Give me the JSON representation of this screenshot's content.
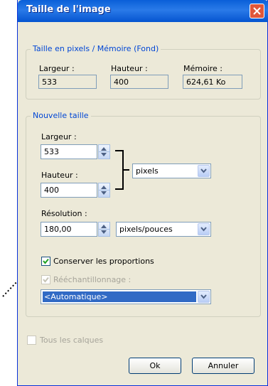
{
  "window": {
    "title": "Taille de l'image"
  },
  "pixel_group": {
    "legend": "Taille en pixels / Mémoire (Fond)",
    "width_label": "Largeur :",
    "width_value": "533",
    "height_label": "Hauteur :",
    "height_value": "400",
    "memory_label": "Mémoire :",
    "memory_value": "624,61 Ko"
  },
  "new_size": {
    "legend": "Nouvelle taille",
    "width_label": "Largeur :",
    "width_value": "533",
    "height_label": "Hauteur :",
    "height_value": "400",
    "unit_select": "pixels",
    "resolution_label": "Résolution :",
    "resolution_value": "180,00",
    "resolution_unit_select": "pixels/pouces",
    "keep_proportions_label": "Conserver les proportions",
    "keep_proportions_checked": true,
    "resample_label": "Rééchantillonnage :",
    "resample_checked": true,
    "resample_enabled": false,
    "resample_select": "<Automatique>"
  },
  "all_layers_label": "Tous les calques",
  "buttons": {
    "ok": "Ok",
    "cancel": "Annuler"
  },
  "icons": [
    "close-icon",
    "spin-up-icon",
    "spin-down-icon",
    "dropdown-arrow-icon",
    "checkmark-icon"
  ]
}
